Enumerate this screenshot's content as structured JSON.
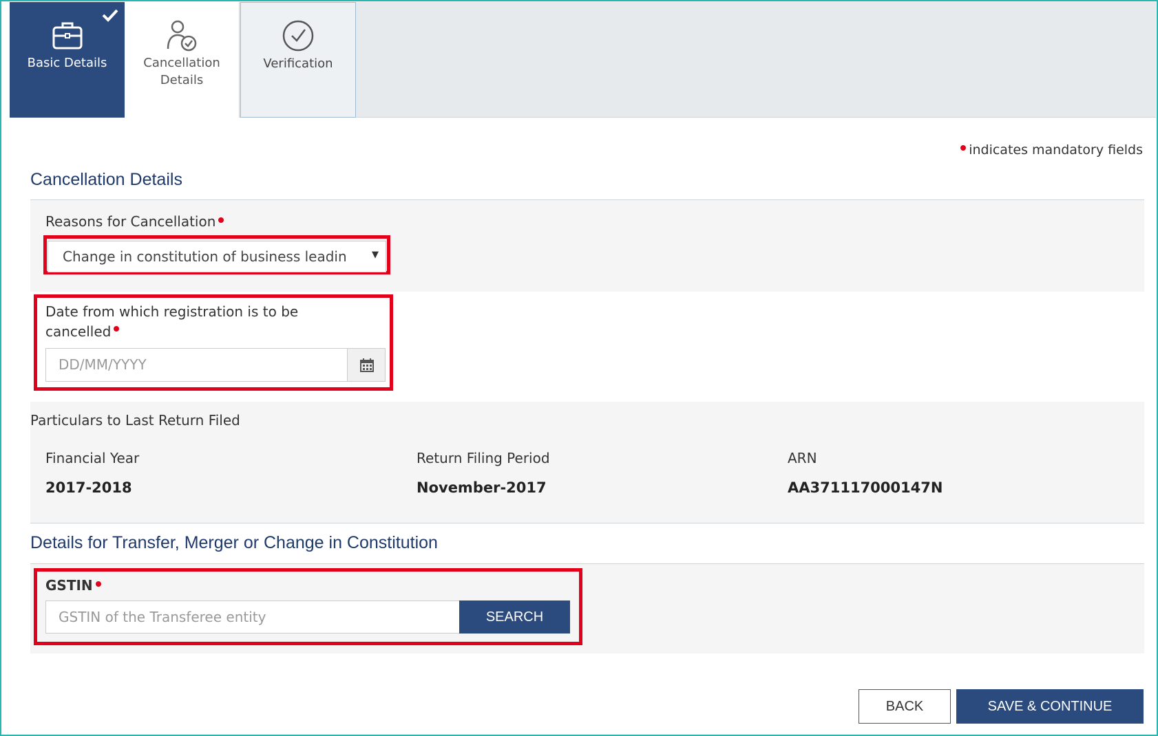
{
  "steps": [
    {
      "label": "Basic Details",
      "completed": true,
      "active": true
    },
    {
      "label_line1": "Cancellation",
      "label_line2": "Details",
      "active": false
    },
    {
      "label": "Verification",
      "active": false
    }
  ],
  "mandatory_note": "indicates mandatory fields",
  "cancellation": {
    "title": "Cancellation Details",
    "reason_label": "Reasons for Cancellation",
    "reason_value": "Change in constitution of business leadin",
    "date_label_line1": "Date from which registration is to be",
    "date_label_line2": "cancelled",
    "date_placeholder": "DD/MM/YYYY"
  },
  "last_return": {
    "title": "Particulars to Last Return Filed",
    "fy_label": "Financial Year",
    "fy_value": "2017-2018",
    "period_label": "Return Filing Period",
    "period_value": "November-2017",
    "arn_label": "ARN",
    "arn_value": "AA371117000147N"
  },
  "transfer": {
    "title": "Details for Transfer, Merger or Change in Constitution",
    "gstin_label": "GSTIN",
    "gstin_placeholder": "GSTIN of the Transferee entity",
    "search_label": "SEARCH"
  },
  "footer": {
    "back_label": "BACK",
    "save_label": "SAVE & CONTINUE"
  },
  "colors": {
    "primary": "#2b4a7e",
    "highlight": "#e3001b",
    "title": "#1f3a6a"
  }
}
